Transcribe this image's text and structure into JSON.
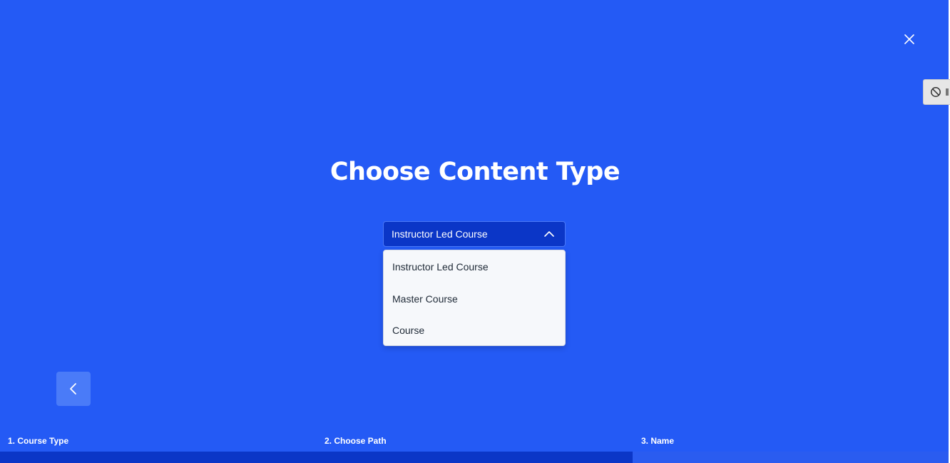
{
  "page": {
    "title": "Choose Content Type"
  },
  "close_icon": "close-icon",
  "side_tab": {
    "icon": "block-icon"
  },
  "content_type_select": {
    "selected": "Instructor Led Course",
    "expanded": true,
    "options": [
      "Instructor Led Course",
      "Master Course",
      "Course"
    ]
  },
  "navigation": {
    "back_icon": "chevron-left-icon"
  },
  "steps": [
    {
      "label": "1. Course Type"
    },
    {
      "label": "2. Choose Path"
    },
    {
      "label": "3. Name"
    }
  ],
  "progress": {
    "fraction": 0.6667
  },
  "colors": {
    "background": "#245AF5",
    "select_bg": "#0B36C7",
    "menu_bg": "#F6F8FB",
    "progress_fill": "#0B36C7",
    "back_button": "#4A7BF8"
  }
}
